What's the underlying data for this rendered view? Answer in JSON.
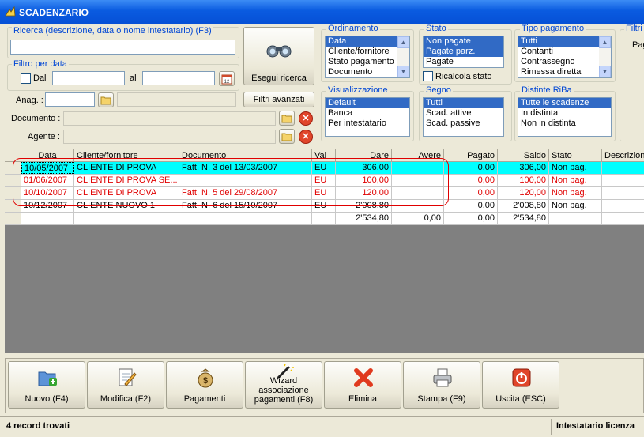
{
  "window": {
    "title": "SCADENZARIO"
  },
  "ricerca": {
    "label": "Ricerca (descrizione, data o nome intestatario) (F3)",
    "value": ""
  },
  "filtro_data": {
    "label": "Filtro per data",
    "dal_label": "Dal",
    "al_label": "al",
    "dal_value": "",
    "al_value": ""
  },
  "anag": {
    "label": "Anag. :",
    "value": ""
  },
  "documento": {
    "label": "Documento :",
    "value": ""
  },
  "agente": {
    "label": "Agente :",
    "value": ""
  },
  "buttons": {
    "esegui": "Esegui ricerca",
    "filtri_avanzati": "Filtri avanzati"
  },
  "ordinamento": {
    "label": "Ordinamento",
    "items": [
      "Data",
      "Cliente/fornitore",
      "Stato pagamento",
      "Documento"
    ],
    "selected": "Data"
  },
  "visualizzazione": {
    "label": "Visualizzazione",
    "items": [
      "Default",
      "Banca",
      "Per intestatario"
    ],
    "selected": "Default"
  },
  "stato": {
    "label": "Stato",
    "items": [
      "Non pagate",
      "Pagate parz.",
      "Pagate"
    ],
    "ricalcola": "Ricalcola stato"
  },
  "segno": {
    "label": "Segno",
    "items": [
      "Tutti",
      "Scad. attive",
      "Scad. passive"
    ]
  },
  "tipo_pagamento": {
    "label": "Tipo pagamento",
    "items": [
      "Tutti",
      "Contanti",
      "Contrassegno",
      "Rimessa diretta"
    ]
  },
  "distinte": {
    "label": "Distinte RiBa",
    "items": [
      "Tutte le scadenze",
      "In distinta",
      "Non in distinta"
    ]
  },
  "filtri_extra": {
    "label": "Filtri a",
    "sub": "Pag"
  },
  "table": {
    "columns": [
      "Data",
      "Cliente/fornitore",
      "Documento",
      "Val",
      "Dare",
      "Avere",
      "Pagato",
      "Saldo",
      "Stato",
      "Descrizion"
    ],
    "rows": [
      {
        "data": "10/05/2007",
        "cliente": "CLIENTE DI PROVA",
        "documento": "Fatt. N. 3 del 13/03/2007",
        "val": "EU",
        "dare": "306,00",
        "avere": "",
        "pagato": "0,00",
        "saldo": "306,00",
        "stato": "Non pag.",
        "descr": ""
      },
      {
        "data": "01/06/2007",
        "cliente": "CLIENTE DI PROVA SE...",
        "documento": "",
        "val": "EU",
        "dare": "100,00",
        "avere": "",
        "pagato": "0,00",
        "saldo": "100,00",
        "stato": "Non pag.",
        "descr": ""
      },
      {
        "data": "10/10/2007",
        "cliente": "CLIENTE DI PROVA",
        "documento": "Fatt. N. 5 del 29/08/2007",
        "val": "EU",
        "dare": "120,00",
        "avere": "",
        "pagato": "0,00",
        "saldo": "120,00",
        "stato": "Non pag.",
        "descr": ""
      },
      {
        "data": "10/12/2007",
        "cliente": "CLIENTE NUOVO 1",
        "documento": "Fatt. N. 6 del 15/10/2007",
        "val": "EU",
        "dare": "2'008,80",
        "avere": "",
        "pagato": "0,00",
        "saldo": "2'008,80",
        "stato": "Non pag.",
        "descr": ""
      }
    ],
    "totals": {
      "dare": "2'534,80",
      "avere": "0,00",
      "pagato": "0,00",
      "saldo": "2'534,80"
    }
  },
  "toolbar": {
    "nuovo": "Nuovo (F4)",
    "modifica": "Modifica (F2)",
    "pagamenti": "Pagamenti",
    "wizard": "Wizard associazione pagamenti (F8)",
    "elimina": "Elimina",
    "stampa": "Stampa (F9)",
    "uscita": "Uscita (ESC)"
  },
  "status": {
    "left": "4 record trovati",
    "right": "Intestatario licenza"
  },
  "colors": {
    "accent": "#316ac5",
    "highlight": "#00ffff",
    "danger": "#e00000"
  }
}
